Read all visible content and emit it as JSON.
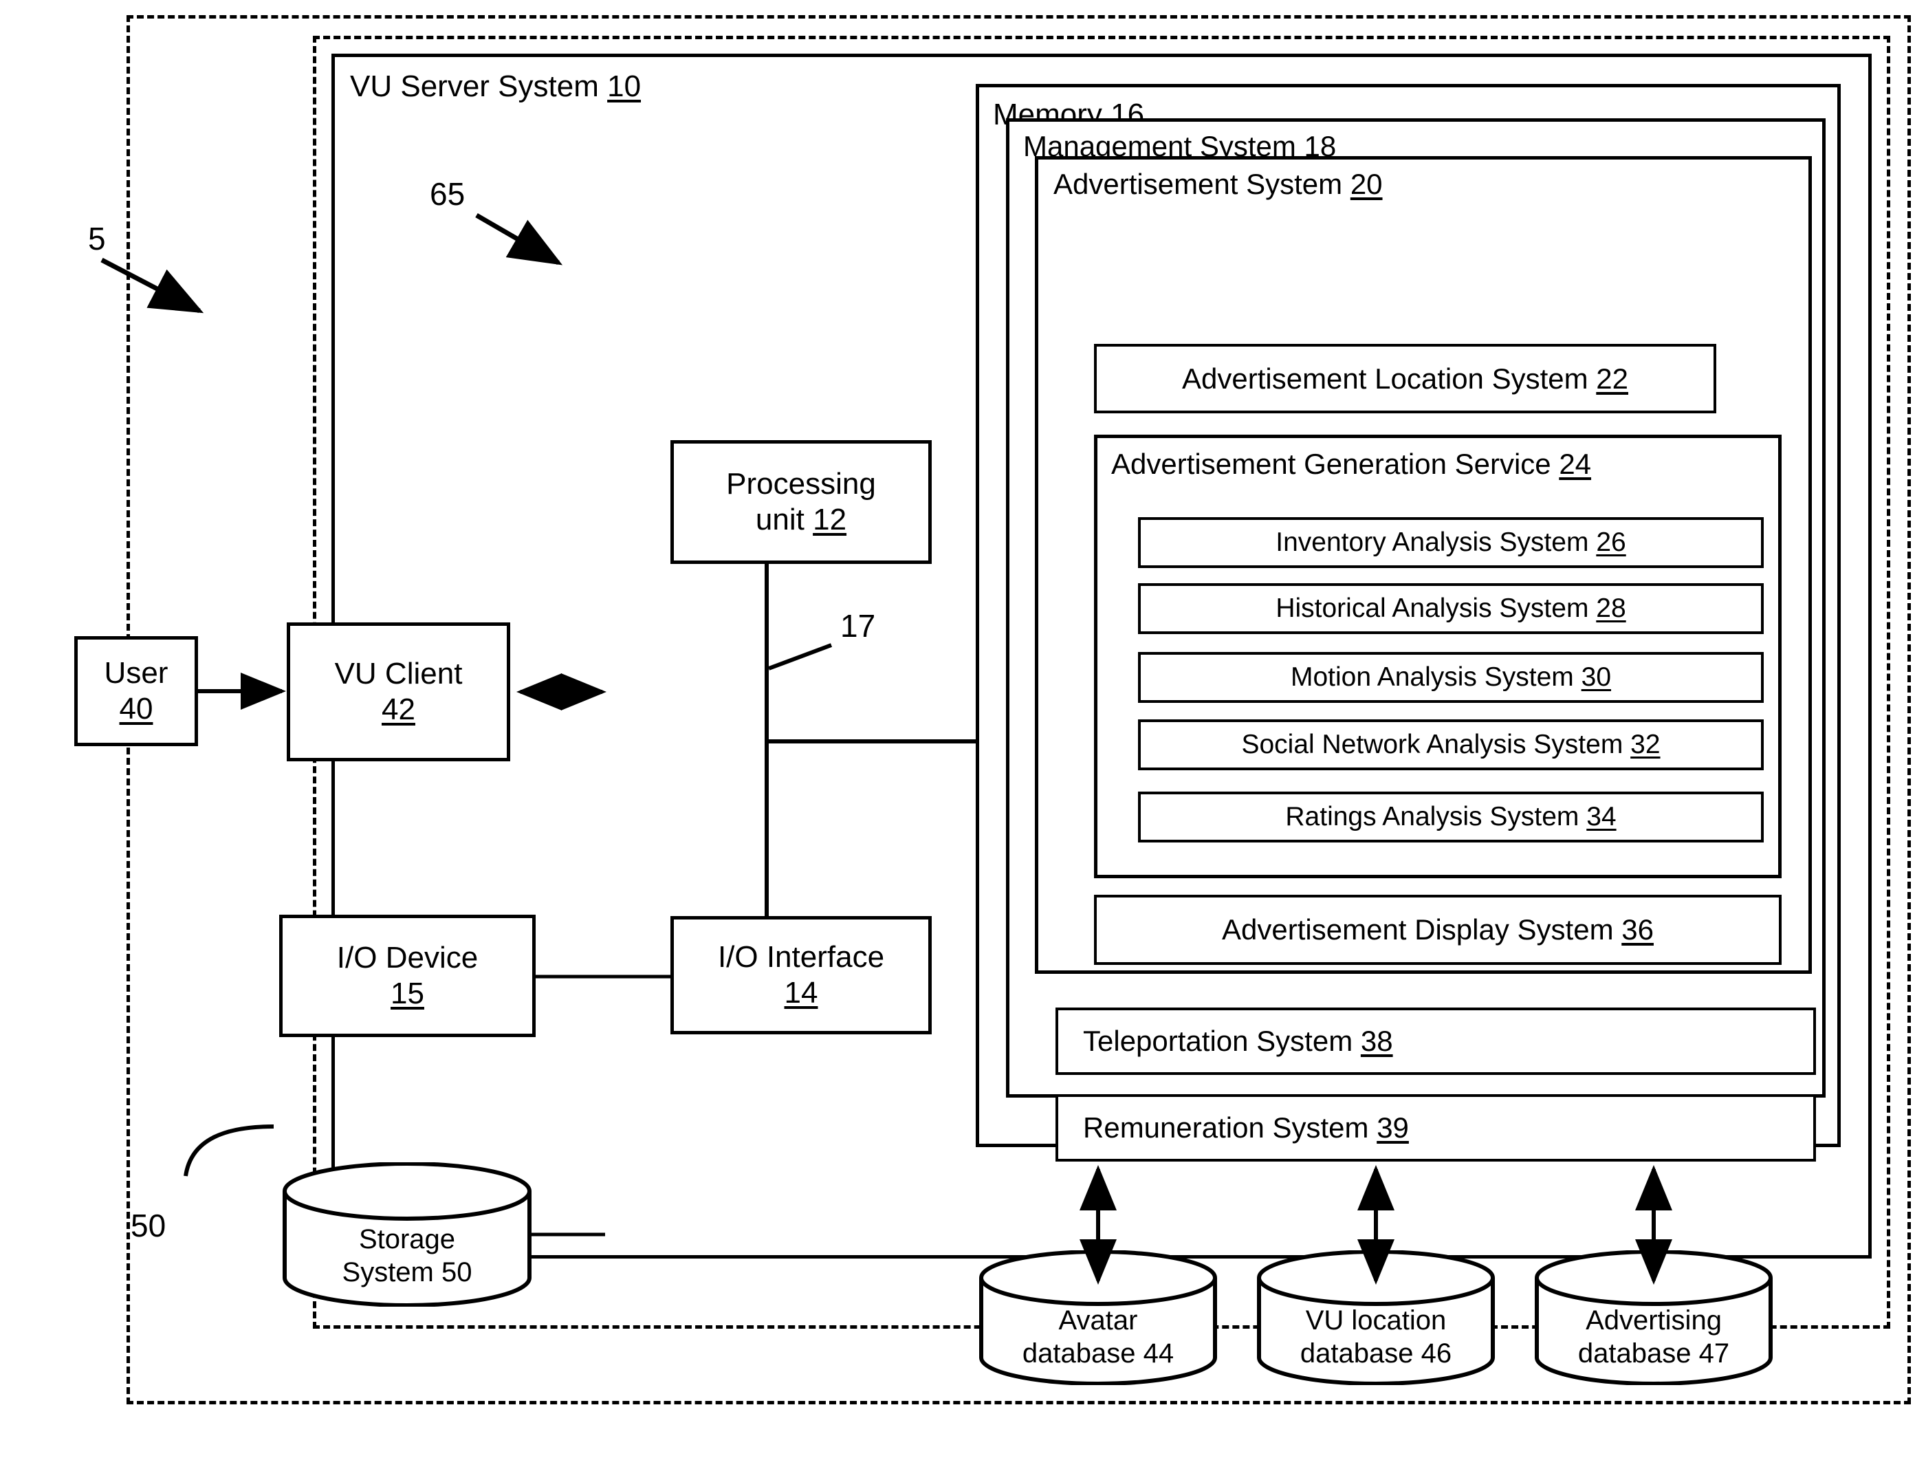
{
  "figure": {
    "reference_numerals": [
      {
        "id": "5",
        "label": "5"
      },
      {
        "id": "65",
        "label": "65"
      },
      {
        "id": "17",
        "label": "17"
      },
      {
        "id": "50",
        "label": "50"
      }
    ]
  },
  "outer_boundary": {
    "name": "system-boundary-5"
  },
  "inner_boundary": {
    "name": "network-boundary-65"
  },
  "server": {
    "title_text": "VU Server System ",
    "title_num": "10"
  },
  "client_side": {
    "user": {
      "line1": "User",
      "num": "40"
    },
    "vu_client": {
      "line1": "VU Client",
      "num": "42"
    },
    "io_device": {
      "line1": "I/O Device",
      "num": "15"
    },
    "storage": {
      "line1": "Storage",
      "line2": "System 50"
    }
  },
  "server_side": {
    "processing_unit": {
      "line1": "Processing",
      "line2_text": "unit ",
      "num": "12"
    },
    "io_interface": {
      "line1": "I/O Interface",
      "num": "14"
    },
    "bus_label": "17"
  },
  "memory": {
    "title_text": "Memory ",
    "title_num": "16"
  },
  "management_system": {
    "title_text": "Management System ",
    "title_num": "18"
  },
  "advertisement_system": {
    "title_text": "Advertisement System ",
    "title_num": "20"
  },
  "advertisement_location_system": {
    "title_text": "Advertisement Location System ",
    "title_num": "22"
  },
  "advertisement_generation_service": {
    "title_text": "Advertisement Generation Service ",
    "title_num": "24"
  },
  "analysis_systems": [
    {
      "text": "Inventory Analysis System ",
      "num": "26"
    },
    {
      "text": "Historical Analysis System ",
      "num": "28"
    },
    {
      "text": "Motion Analysis System ",
      "num": "30"
    },
    {
      "text": "Social Network Analysis System ",
      "num": "32"
    },
    {
      "text": "Ratings Analysis System ",
      "num": "34"
    }
  ],
  "advertisement_display_system": {
    "title_text": "Advertisement Display System ",
    "title_num": "36"
  },
  "teleportation_system": {
    "title_text": "Teleportation System ",
    "title_num": "38"
  },
  "remuneration_system": {
    "title_text": "Remuneration System ",
    "title_num": "39"
  },
  "databases": [
    {
      "line1": "Avatar",
      "line2": "database 44"
    },
    {
      "line1": "VU location",
      "line2": "database 46"
    },
    {
      "line1": "Advertising",
      "line2": "database 47"
    }
  ],
  "colors": {
    "stroke": "#000000",
    "background": "#ffffff"
  }
}
